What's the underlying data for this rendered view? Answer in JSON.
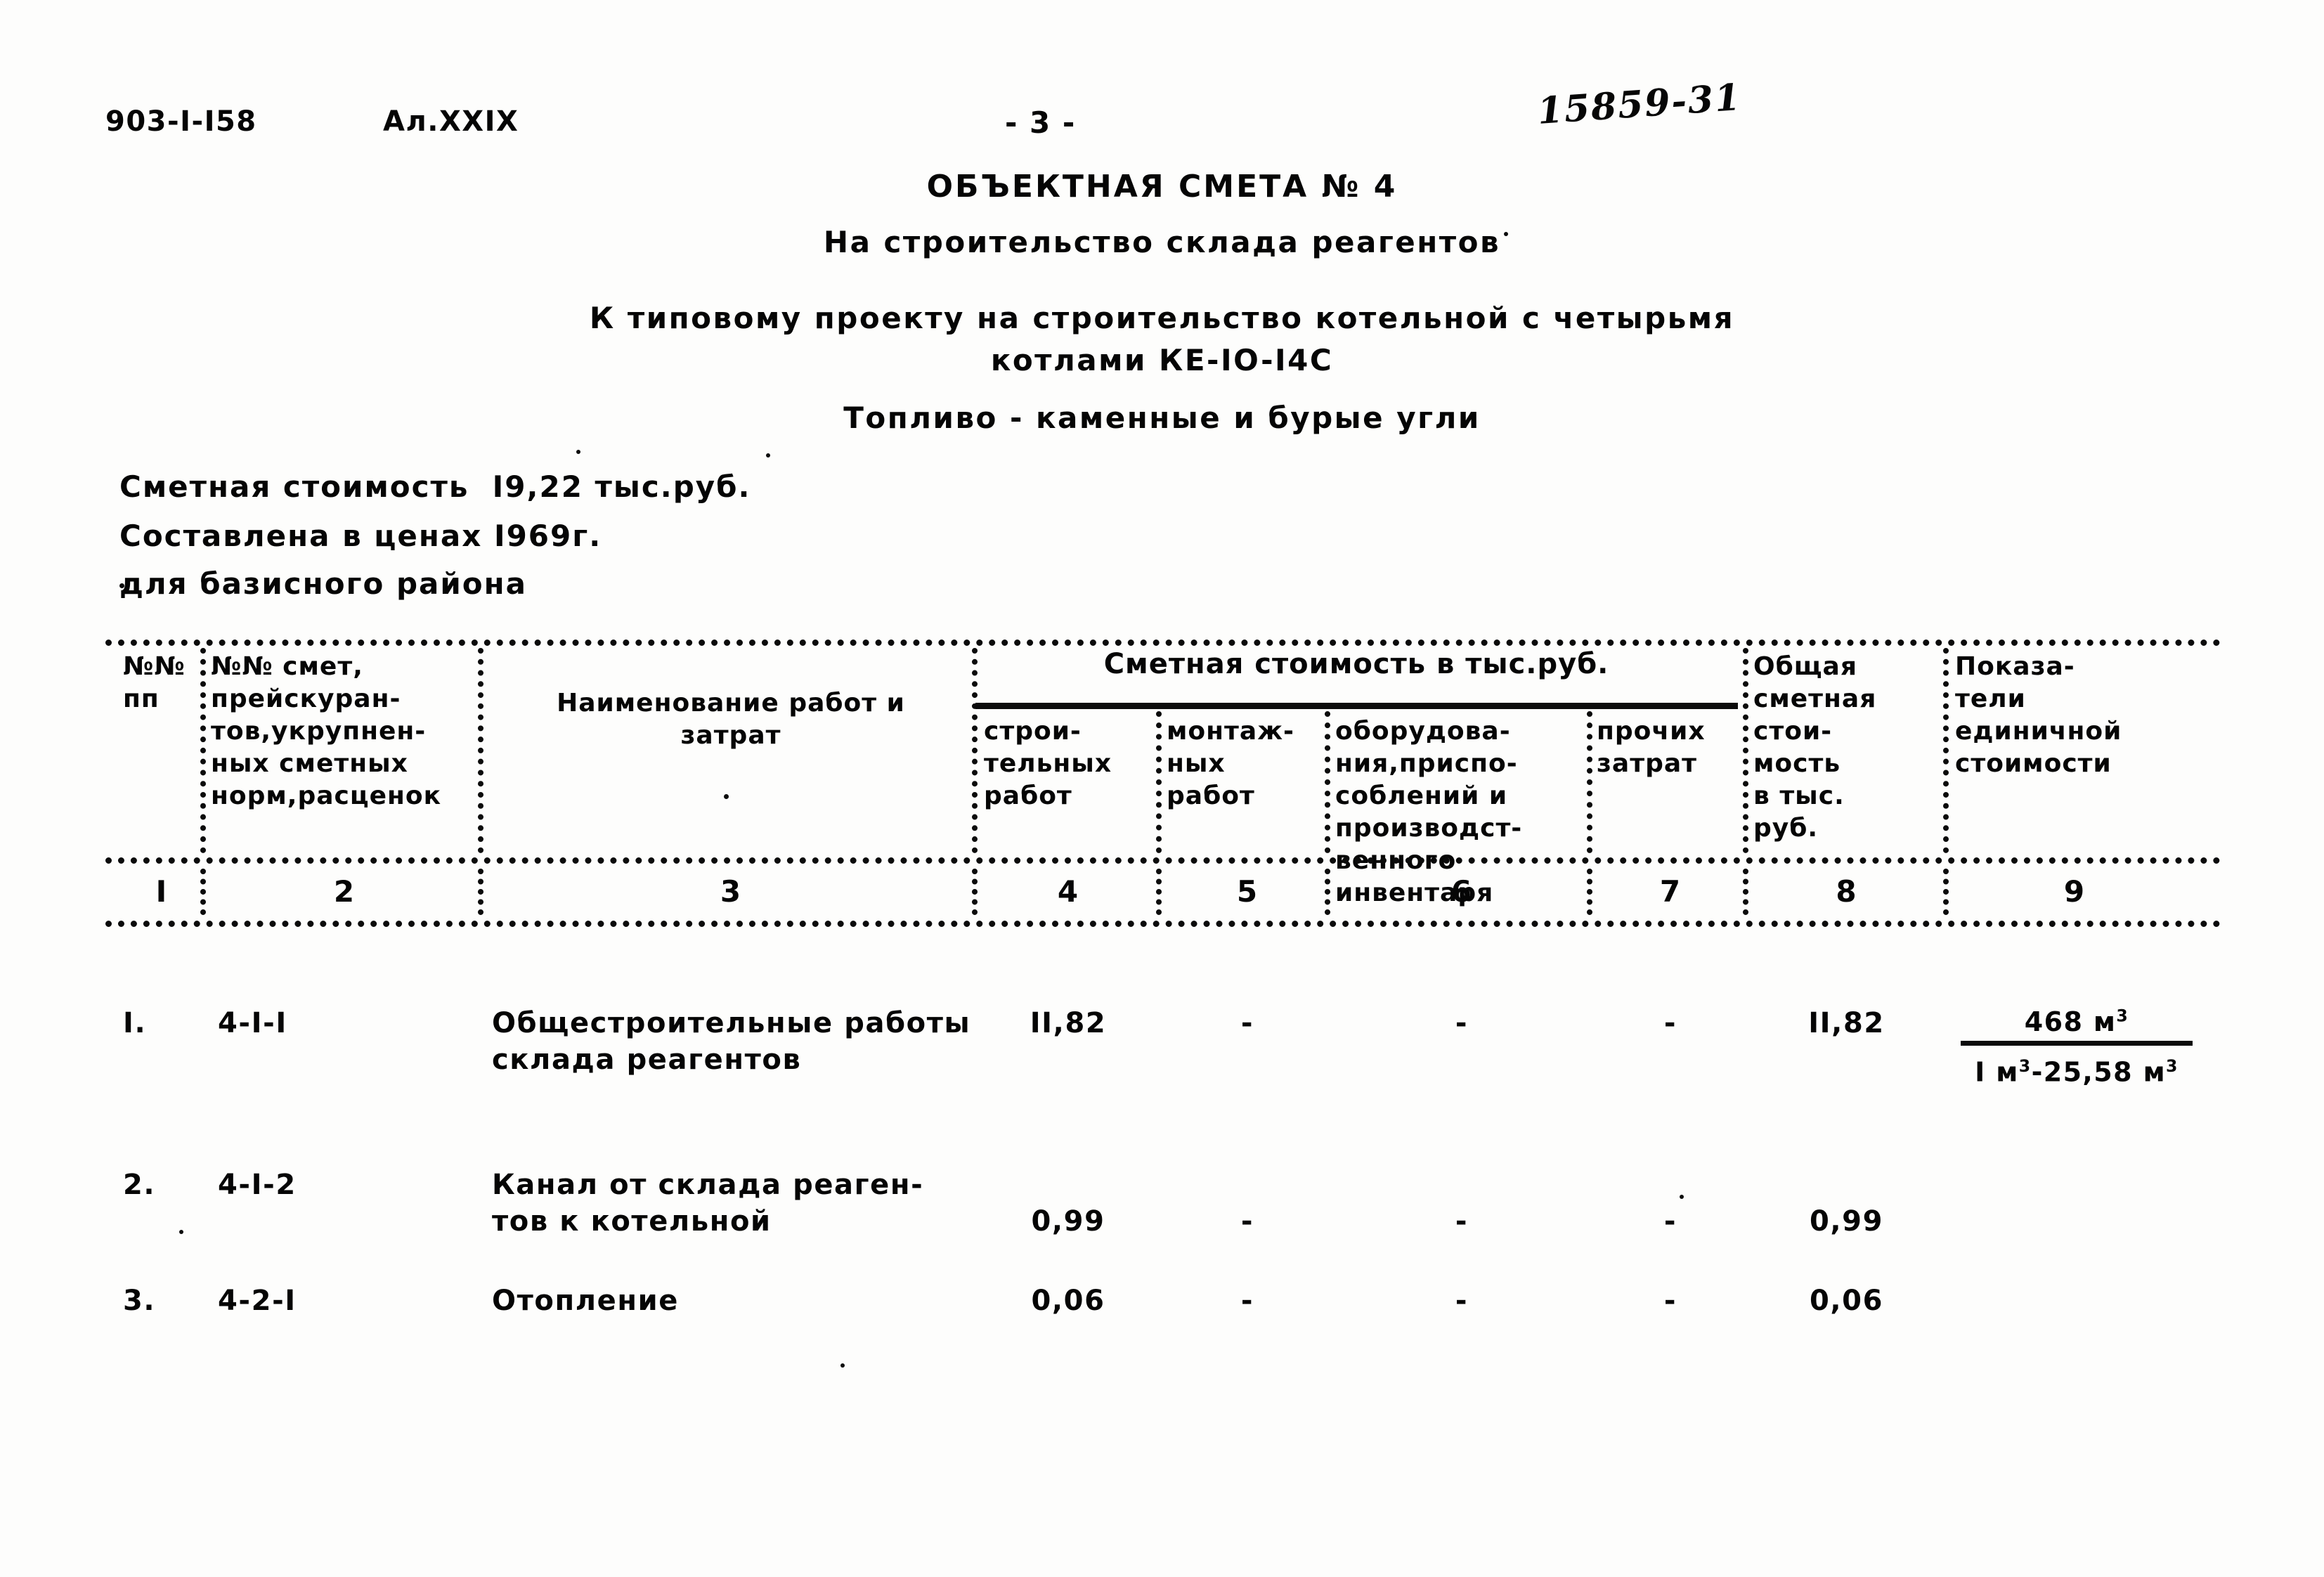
{
  "header": {
    "project_code": "903-I-I58",
    "album": "Ал.XXIX",
    "page_marker": "- 3 -",
    "handwritten_note": "15859-31"
  },
  "title": {
    "main": "ОБЪЕКТНАЯ СМЕТА № 4",
    "subtitle_1": "На строительство склада реагентов",
    "subtitle_2": "К типовому проекту на строительство котельной с четырьмя",
    "subtitle_3": "котлами КЕ-IO-I4C",
    "fuel_line": "Топливо - каменные и бурые угли"
  },
  "meta": {
    "estimate_cost": "Сметная стоимость  I9,22 тыс.руб.",
    "prices_year": "Составлена в ценах I969г.",
    "region": "для базисного района"
  },
  "table": {
    "group_header": "Сметная стоимость в тыс.руб.",
    "columns": [
      {
        "num": "I",
        "label": "№№\nпп"
      },
      {
        "num": "2",
        "label": "№№ смет,\nпрейскуран-\nтов,укрупнен-\nных сметных\nнорм,расценок"
      },
      {
        "num": "3",
        "label": "Наименование работ и\nзатрат"
      },
      {
        "num": "4",
        "label": "строи-\nтельных\nработ"
      },
      {
        "num": "5",
        "label": "монтаж-\nных\nработ"
      },
      {
        "num": "6",
        "label": "оборудова-\nния,приспо-\nсоблений и\nпроизводст-\nвенного\nинвентаря"
      },
      {
        "num": "7",
        "label": "прочих\nзатрат"
      },
      {
        "num": "8",
        "label": "Общая\nсметная\nстои-\nмость\nв тыс.\nруб."
      },
      {
        "num": "9",
        "label": "Показа-\nтели\nединичной\nстоимости"
      }
    ],
    "rows": [
      {
        "no": "I.",
        "code": "4-I-I",
        "name": "Общестроительные работы\nсклада реагентов",
        "construction": "II,82",
        "installation": "-",
        "equipment": "-",
        "other": "-",
        "total": "II,82",
        "unit_numerator": "468 м3",
        "unit_denominator": "I м3-25,58 м3"
      },
      {
        "no": "2.",
        "code": "4-I-2",
        "name": "Канал от склада реаген-\nтов к котельной",
        "construction": "0,99",
        "installation": "-",
        "equipment": "-",
        "other": "-",
        "total": "0,99",
        "unit_numerator": "",
        "unit_denominator": ""
      },
      {
        "no": "3.",
        "code": "4-2-I",
        "name": "Отопление",
        "construction": "0,06",
        "installation": "-",
        "equipment": "-",
        "other": "-",
        "total": "0,06",
        "unit_numerator": "",
        "unit_denominator": ""
      }
    ]
  },
  "colors": {
    "ink": "#0b0b0b",
    "paper": "#fdfdfc"
  }
}
